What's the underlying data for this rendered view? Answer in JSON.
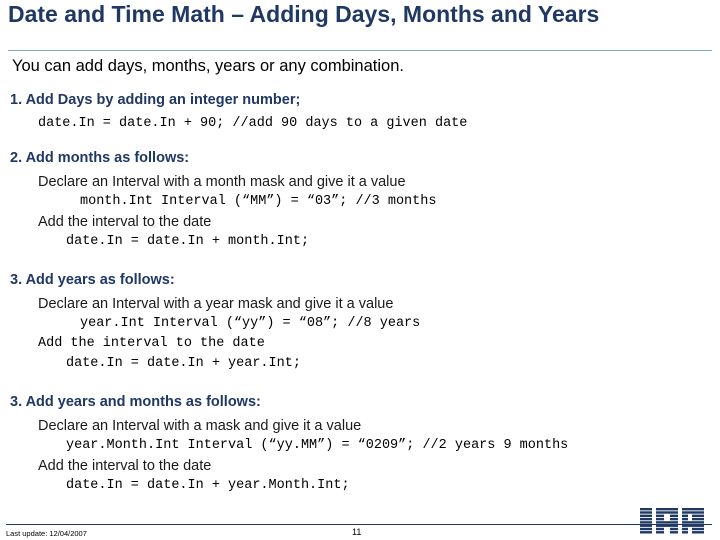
{
  "slide": {
    "title": "Date and Time Math – Adding Days, Months and Years",
    "intro": "You can add days, months, years or any combination.",
    "steps": [
      {
        "heading": "1. Add Days by adding an integer number;",
        "lines": [
          {
            "style": "mono",
            "indent": 2,
            "text": "date.In = date.In + 90;   //add 90 days to a given date"
          }
        ]
      },
      {
        "heading": "2. Add months as follows:",
        "lines": [
          {
            "style": "sans",
            "indent": 2,
            "text": "Declare an Interval with a month mask and give it a value"
          },
          {
            "style": "mono",
            "indent": 4,
            "text": "month.Int        Interval (“MM”) = “03”; //3 months"
          },
          {
            "style": "sans",
            "indent": 2,
            "text": "Add the interval to the date"
          },
          {
            "style": "mono",
            "indent": 3,
            "text": "date.In = date.In + month.Int;"
          }
        ]
      },
      {
        "heading": "3. Add years as follows:",
        "lines": [
          {
            "style": "sans",
            "indent": 2,
            "text": "Declare an Interval with a year mask and give it a value"
          },
          {
            "style": "mono",
            "indent": 4,
            "text": "year.Int        Interval (“yy”) = “08”; //8 years"
          },
          {
            "style": "mono",
            "indent": 2,
            "text": "Add the interval to the date"
          },
          {
            "style": "mono",
            "indent": 3,
            "text": "date.In = date.In + year.Int;"
          }
        ]
      },
      {
        "heading": "3. Add years and months as follows:",
        "lines": [
          {
            "style": "sans",
            "indent": 2,
            "text": "Declare an Interval with a mask and give it a value"
          },
          {
            "style": "mono",
            "indent": 3,
            "text": "year.Month.Int   Interval (“yy.MM”) = “0209”; //2 years 9 months"
          },
          {
            "style": "sans",
            "indent": 2,
            "text": "Add the interval to the date"
          },
          {
            "style": "mono",
            "indent": 3,
            "text": "date.In = date.In + year.Month.Int;"
          }
        ]
      }
    ],
    "footer": {
      "last_update": "Last update: 12/04/2007",
      "page_number": "11",
      "logo_text": "IBM"
    },
    "colors": {
      "title": "#1f3864",
      "rule": "#7ea7c4",
      "logo": "#1f3864"
    }
  }
}
